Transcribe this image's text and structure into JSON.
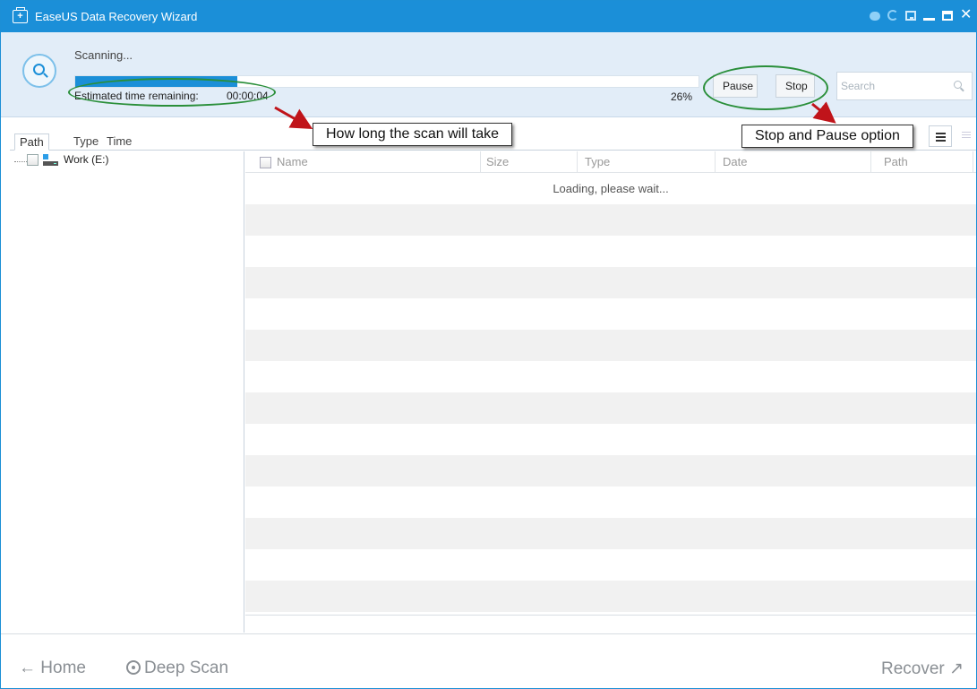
{
  "window": {
    "title": "EaseUS Data Recovery Wizard",
    "brand_color": "#1b8fd8"
  },
  "scan": {
    "status": "Scanning...",
    "progress_percent": 26,
    "progress_label": "26%",
    "estimated_label": "Estimated time remaining:",
    "estimated_value": "00:00:04",
    "pause_label": "Pause",
    "stop_label": "Stop",
    "search_placeholder": "Search"
  },
  "tabs": [
    {
      "label": "Path",
      "active": true
    },
    {
      "label": "Type",
      "active": false
    },
    {
      "label": "Time",
      "active": false
    }
  ],
  "tree": {
    "items": [
      {
        "label": "Work (E:)",
        "checked": false
      }
    ]
  },
  "table": {
    "columns": [
      "Name",
      "Size",
      "Type",
      "Date",
      "Path"
    ],
    "loading_text": "Loading, please wait..."
  },
  "footer": {
    "home_label": "Home",
    "deep_scan_label": "Deep Scan",
    "recover_label": "Recover"
  },
  "annotations": {
    "time_callout": "How long the scan will take",
    "stop_pause_callout": "Stop and Pause option",
    "oval_color": "#2a8f3a",
    "arrow_color": "#c0141a"
  },
  "icons": {
    "back": "←",
    "recover": "↗",
    "close": "✕"
  }
}
